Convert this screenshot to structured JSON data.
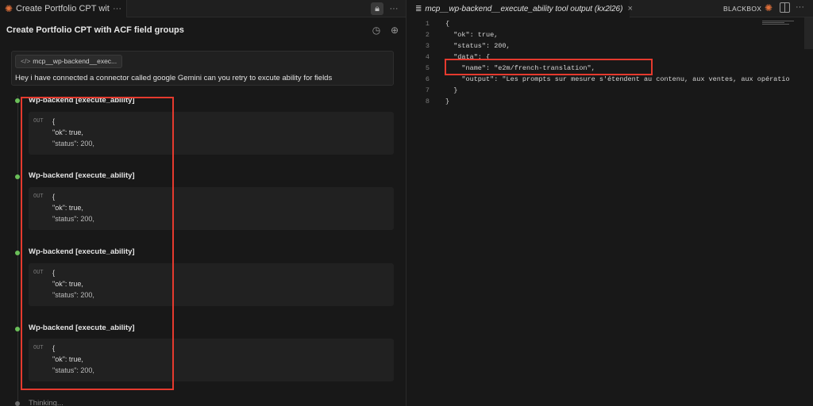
{
  "left": {
    "tab": {
      "title": "Create Portfolio CPT wit...",
      "close": "···"
    },
    "header": {
      "title": "Create Portfolio CPT with ACF field groups"
    },
    "message": {
      "chip": "mcp__wp-backend__exec...",
      "text": "Hey i have connected a connector called google Gemini can you retry to excute ability for fields"
    },
    "blocks": [
      {
        "title": "Wp-backend [execute_ability]",
        "out": "OUT",
        "line1": "{",
        "line2": "\"ok\": true,",
        "line3": "\"status\": 200,"
      },
      {
        "title": "Wp-backend [execute_ability]",
        "out": "OUT",
        "line1": "{",
        "line2": "\"ok\": true,",
        "line3": "\"status\": 200,"
      },
      {
        "title": "Wp-backend [execute_ability]",
        "out": "OUT",
        "line1": "{",
        "line2": "\"ok\": true,",
        "line3": "\"status\": 200,"
      },
      {
        "title": "Wp-backend [execute_ability]",
        "out": "OUT",
        "line1": "{",
        "line2": "\"ok\": true,",
        "line3": "\"status\": 200,"
      }
    ],
    "thinking": "Thinking..."
  },
  "right": {
    "tab": {
      "title": "mcp__wp-backend__execute_ability tool output (kx2l26)",
      "close": "×"
    },
    "brand": "BLACKBOX",
    "lines": [
      {
        "n": "1",
        "code": "{"
      },
      {
        "n": "2",
        "code": "  \"ok\": true,"
      },
      {
        "n": "3",
        "code": "  \"status\": 200,"
      },
      {
        "n": "4",
        "code": "  \"data\": {"
      },
      {
        "n": "5",
        "code": "    \"name\": \"e2m/french-translation\","
      },
      {
        "n": "6",
        "code": "    \"output\": \"Les prompts sur mesure s'étendent au contenu, aux ventes, aux opératio"
      },
      {
        "n": "7",
        "code": "  }"
      },
      {
        "n": "8",
        "code": "}"
      }
    ]
  },
  "colors": {
    "accent": "#e0703a",
    "highlight": "#e53a2e",
    "status_dot": "#6bbf59"
  }
}
